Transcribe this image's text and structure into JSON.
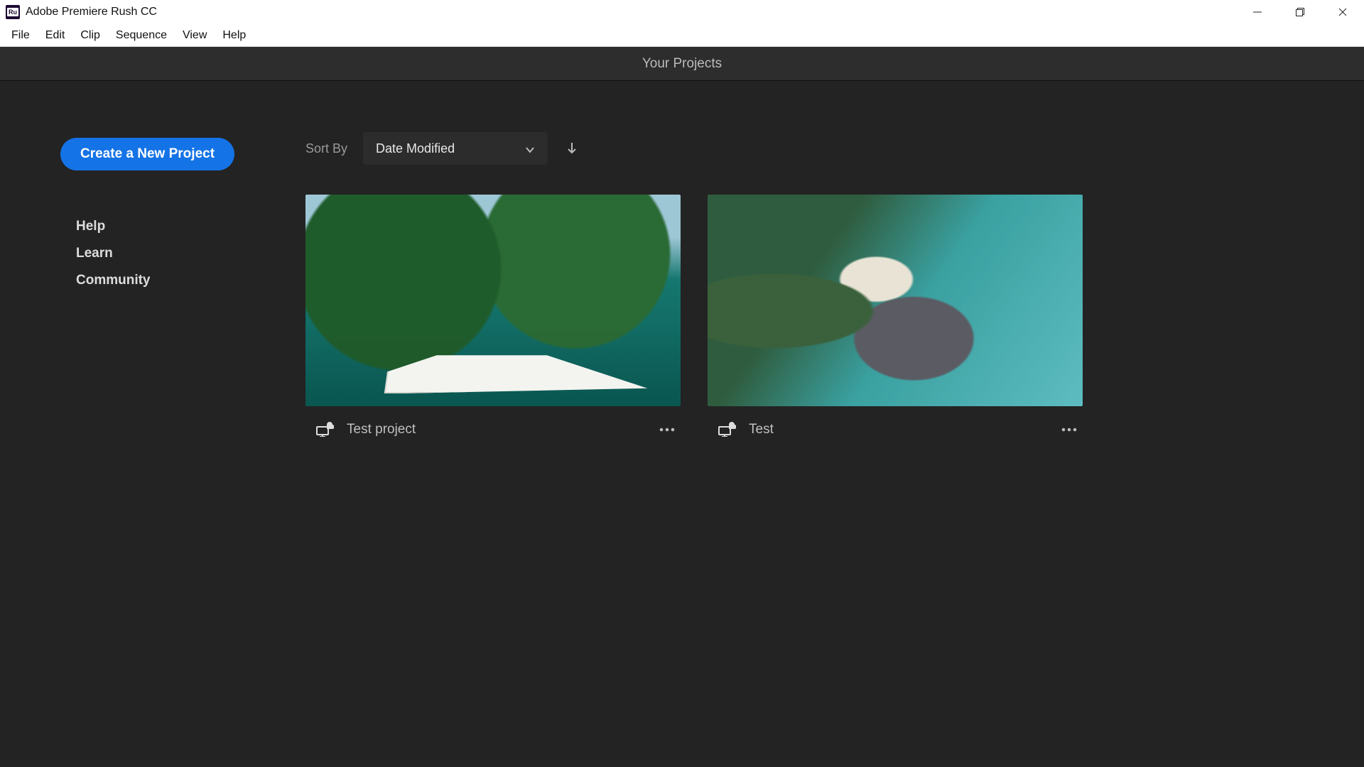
{
  "window": {
    "app_icon_label": "Ru",
    "title": "Adobe Premiere Rush CC"
  },
  "menubar": [
    "File",
    "Edit",
    "Clip",
    "Sequence",
    "View",
    "Help"
  ],
  "page_title": "Your Projects",
  "sidebar": {
    "create_label": "Create a New Project",
    "links": [
      "Help",
      "Learn",
      "Community"
    ]
  },
  "sort": {
    "label": "Sort By",
    "selected": "Date Modified",
    "direction": "descending"
  },
  "projects": [
    {
      "name": "Test project"
    },
    {
      "name": "Test"
    }
  ]
}
